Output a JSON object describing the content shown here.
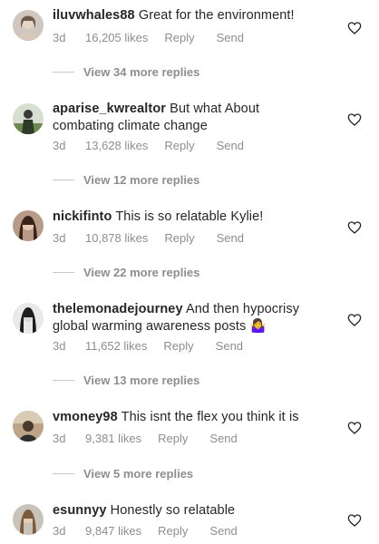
{
  "comments": [
    {
      "username": "iluvwhales88",
      "text": "Great for the environment!",
      "age": "3d",
      "likes": "16,205 likes",
      "reply": "Reply",
      "send": "Send",
      "more_replies": "View 34 more replies"
    },
    {
      "username": "aparise_kwrealtor",
      "text": "But what About combating climate change",
      "age": "3d",
      "likes": "13,628 likes",
      "reply": "Reply",
      "send": "Send",
      "more_replies": "View 12 more replies"
    },
    {
      "username": "nickifinto",
      "text": "This is so relatable Kylie!",
      "age": "3d",
      "likes": "10,878 likes",
      "reply": "Reply",
      "send": "Send",
      "more_replies": "View 22 more replies"
    },
    {
      "username": "thelemonadejourney",
      "text": "And then hypocrisy global warming awareness posts 🤷‍♀️",
      "age": "3d",
      "likes": "11,652 likes",
      "reply": "Reply",
      "send": "Send",
      "more_replies": "View 13 more replies"
    },
    {
      "username": "vmoney98",
      "text": "This isnt the flex you think it is",
      "age": "3d",
      "likes": "9,381 likes",
      "reply": "Reply",
      "send": "Send",
      "more_replies": "View 5 more replies"
    },
    {
      "username": "esunnyy",
      "text": "Honestly so relatable",
      "age": "3d",
      "likes": "9,847 likes",
      "reply": "Reply",
      "send": "Send"
    }
  ],
  "icons": {
    "like": "heart-outline-icon"
  },
  "colors": {
    "text": "#262626",
    "secondary": "#8e8e8e"
  }
}
